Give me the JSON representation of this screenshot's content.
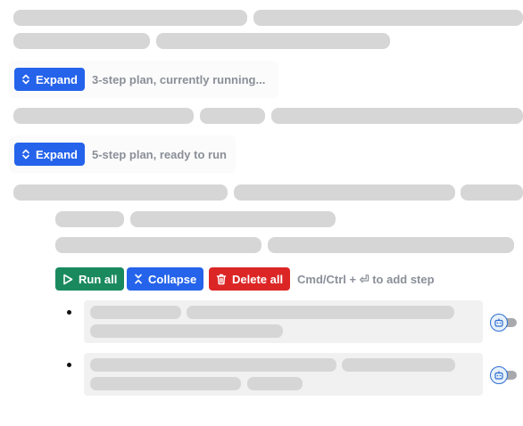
{
  "plans": [
    {
      "expand_label": "Expand",
      "status": "3-step plan, currently running..."
    },
    {
      "expand_label": "Expand",
      "status": "5-step plan, ready to run"
    }
  ],
  "toolbar": {
    "run_all": "Run all",
    "collapse": "Collapse",
    "delete_all": "Delete all",
    "hint": "Cmd/Ctrl + ⏎ to add step"
  },
  "colors": {
    "primary": "#2563eb",
    "success": "#1a8a5e",
    "danger": "#dc2626",
    "placeholder": "#d6d6d6"
  },
  "icons": [
    "expand-chevrons-icon",
    "play-icon",
    "collapse-icon",
    "trash-icon",
    "bot-icon"
  ]
}
